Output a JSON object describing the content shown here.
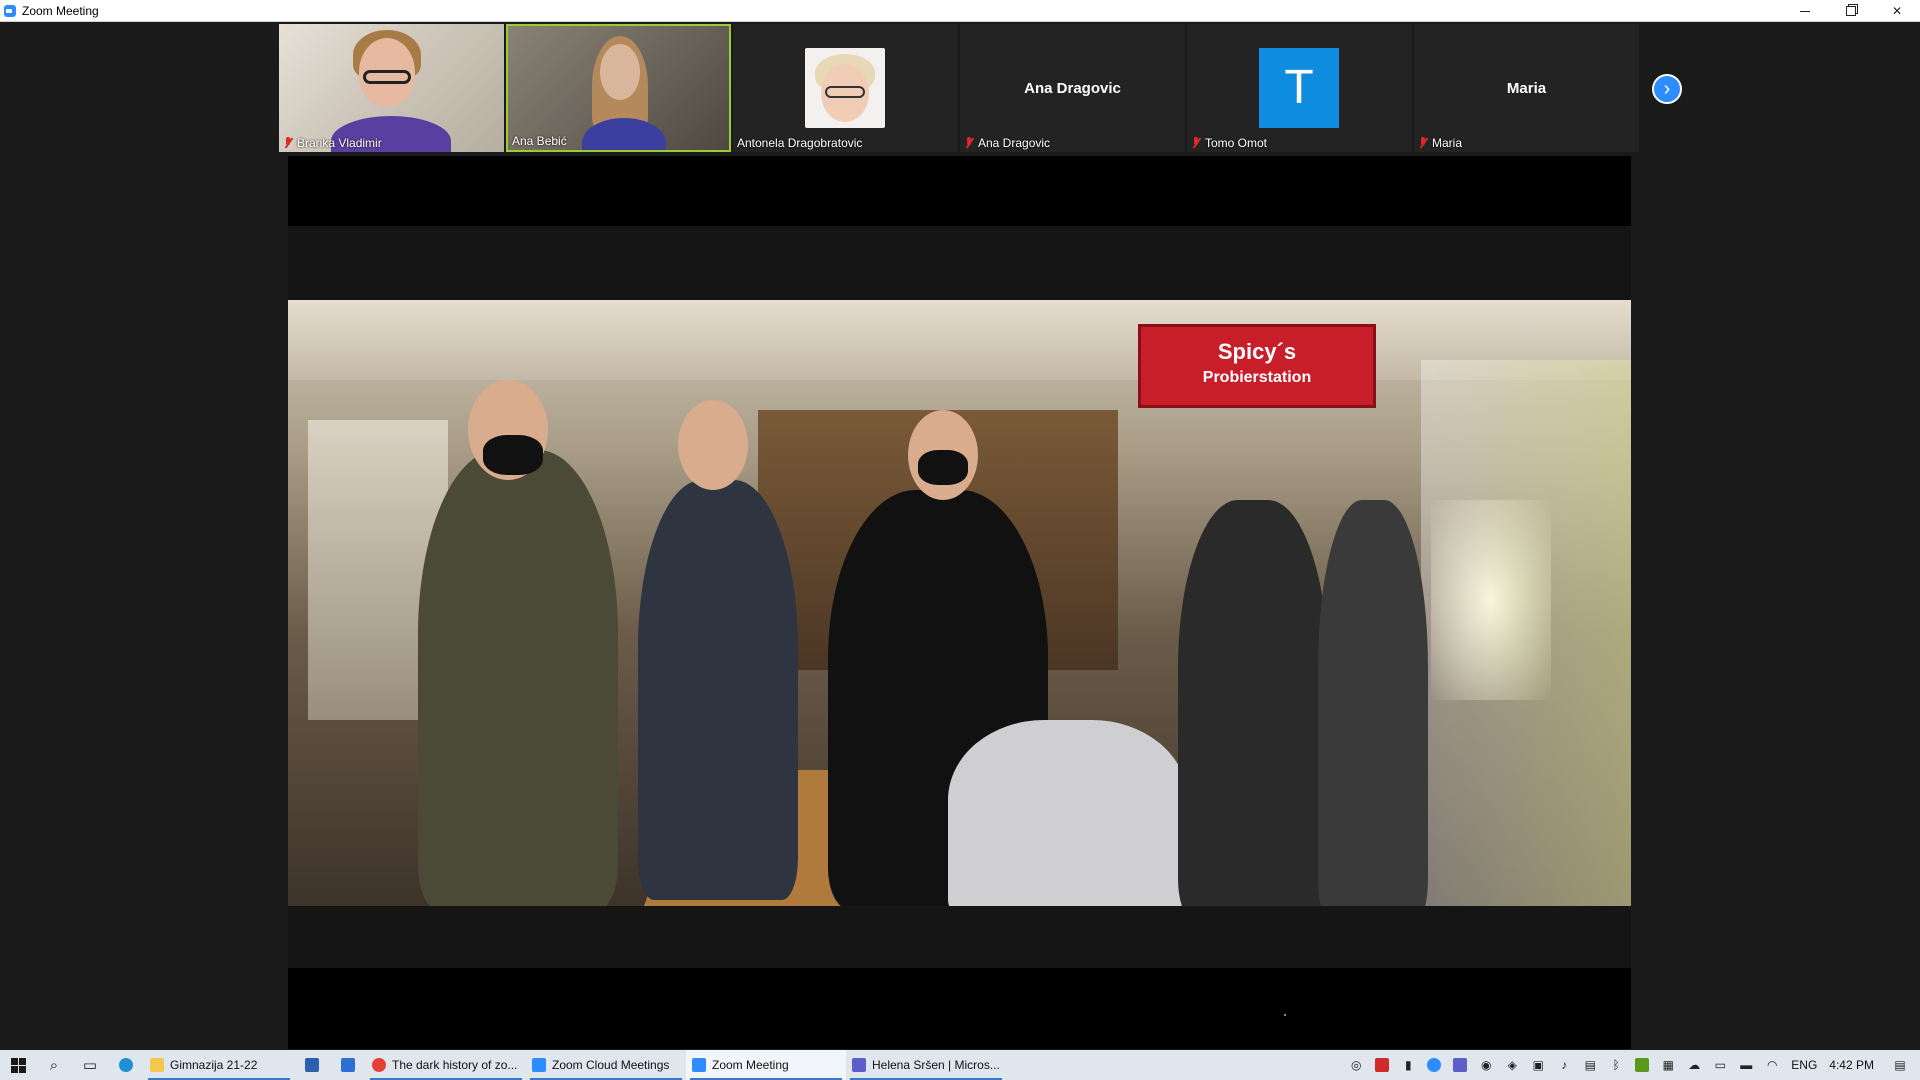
{
  "window": {
    "title": "Zoom Meeting",
    "controls": {
      "minimize": "—",
      "restore": "❐",
      "close": "✕"
    }
  },
  "gallery": {
    "participants": [
      {
        "name": "Branka Vladimir",
        "muted": true,
        "type": "video"
      },
      {
        "name": "Ana Bebić",
        "muted": false,
        "type": "video",
        "active_speaker": true
      },
      {
        "name": "Antonela Dragobratovic",
        "muted": false,
        "type": "avatar"
      },
      {
        "name": "Ana Dragovic",
        "display_name": "Ana Dragovic",
        "muted": true,
        "type": "name"
      },
      {
        "name": "Tomo Omot",
        "initial": "T",
        "muted": true,
        "type": "initial"
      },
      {
        "name": "Maria",
        "display_name": "Maria",
        "muted": true,
        "type": "name"
      }
    ],
    "next_icon": "›"
  },
  "shared_video": {
    "sign_line1": "Spicy´s",
    "sign_line2": "Probierstation"
  },
  "taskbar": {
    "apps": [
      {
        "label": "Gimnazija 21-22",
        "icon": "folder-icon",
        "color": "#f2c94c"
      },
      {
        "label": "The dark history of zo...",
        "icon": "chrome-icon",
        "color": "#e34133"
      },
      {
        "label": "Zoom Cloud Meetings",
        "icon": "zoom-icon",
        "color": "#2d8cff"
      },
      {
        "label": "Zoom Meeting",
        "icon": "zoom-icon",
        "color": "#2d8cff"
      },
      {
        "label": "Helena Sršen | Micros...",
        "icon": "teams-icon",
        "color": "#5b5fc7"
      }
    ],
    "tray": {
      "language": "ENG",
      "time": "4:42 PM"
    }
  }
}
